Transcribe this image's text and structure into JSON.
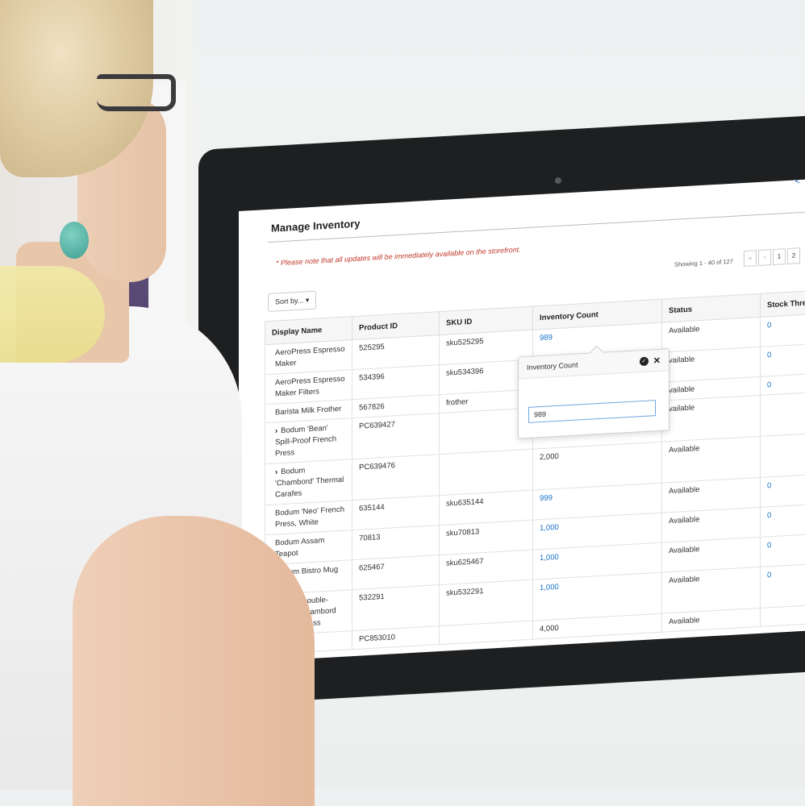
{
  "screen": {
    "title": "Manage Inventory",
    "back_link": "<",
    "note": "* Please note that all updates will be immediately available on the storefront.",
    "showing": "Showing 1 - 40 of 127",
    "pager": [
      "«",
      "‹",
      "1",
      "2"
    ],
    "sort_label": "Sort by... ▾",
    "columns": [
      "Display Name",
      "Product ID",
      "SKU ID",
      "Inventory Count",
      "Status",
      "Stock Thre"
    ],
    "rows": [
      {
        "chev": "",
        "name": "AeroPress Espresso Maker",
        "product_id": "525295",
        "sku": "sku525295",
        "count": "989",
        "count_link": true,
        "status": "Available",
        "threshold": "0"
      },
      {
        "chev": "",
        "name": "AeroPress Espresso Maker Filters",
        "product_id": "534396",
        "sku": "sku534396",
        "count": "",
        "count_link": false,
        "status": "vailable",
        "threshold": "0"
      },
      {
        "chev": "",
        "name": "Barista Milk Frother",
        "product_id": "567826",
        "sku": "frother",
        "count": "",
        "count_link": false,
        "status": "vailable",
        "threshold": "0"
      },
      {
        "chev": "›",
        "name": "Bodum 'Bean' Spill-Proof French Press",
        "product_id": "PC639427",
        "sku": "",
        "count": "",
        "count_link": false,
        "status": "vailable",
        "threshold": ""
      },
      {
        "chev": "›",
        "name": "Bodum 'Chambord' Thermal Carafes",
        "product_id": "PC639476",
        "sku": "",
        "count": "2,000",
        "count_link": false,
        "status": "Available",
        "threshold": ""
      },
      {
        "chev": "",
        "name": "Bodum 'Neo' French Press, White",
        "product_id": "635144",
        "sku": "sku635144",
        "count": "999",
        "count_link": true,
        "status": "Available",
        "threshold": "0"
      },
      {
        "chev": "",
        "name": "Bodum Assam Teapot",
        "product_id": "70813",
        "sku": "sku70813",
        "count": "1,000",
        "count_link": true,
        "status": "Available",
        "threshold": "0"
      },
      {
        "chev": "",
        "name": "Bodum Bistro Mug Press",
        "product_id": "625467",
        "sku": "sku625467",
        "count": "1,000",
        "count_link": true,
        "status": "Available",
        "threshold": "0"
      },
      {
        "chev": "",
        "name": "Bodum Double-Walled Chambord French Press",
        "product_id": "532291",
        "sku": "sku532291",
        "count": "1,000",
        "count_link": true,
        "status": "Available",
        "threshold": "0"
      },
      {
        "chev": "",
        "name": "m French",
        "product_id": "PC853010",
        "sku": "",
        "count": "4,000",
        "count_link": false,
        "status": "Available",
        "threshold": ""
      }
    ],
    "popover": {
      "title": "Inventory Count",
      "value": "989"
    }
  }
}
